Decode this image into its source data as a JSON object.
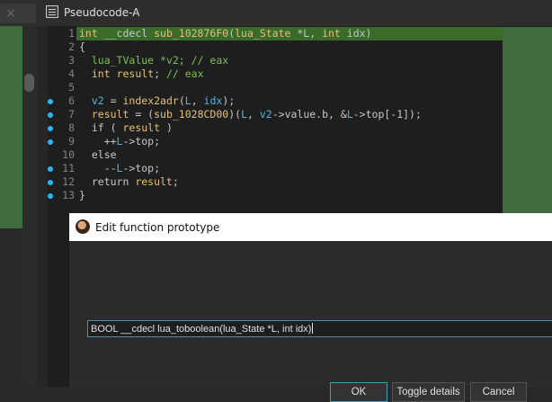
{
  "window": {
    "tab_title": "Pseudocode-A",
    "tab_close_glyph": "×"
  },
  "editor": {
    "lines": [
      {
        "num": "1",
        "bp": false,
        "html": "<span class=\"kw\">int</span> __cdecl <span class=\"fn\">sub_102876F0</span>(<span class=\"kw\">lua_State</span> *L, <span class=\"kw\">int</span> idx)"
      },
      {
        "num": "2",
        "bp": false,
        "html": "{"
      },
      {
        "num": "3",
        "bp": false,
        "html": "  <span class=\"cmt\">lua_TValue *v2; // eax</span>"
      },
      {
        "num": "4",
        "bp": false,
        "html": "  <span class=\"kw\">int</span> <span class=\"kw\">result</span>; <span class=\"cmt\">// eax</span>"
      },
      {
        "num": "5",
        "bp": false,
        "html": ""
      },
      {
        "num": "6",
        "bp": true,
        "html": "  <span class=\"vr\">v2</span> = <span class=\"fn\">index2adr</span>(<span class=\"vr\">L</span>, <span class=\"vr\">idx</span>);"
      },
      {
        "num": "7",
        "bp": true,
        "html": "  <span class=\"kw\">result</span> = (<span class=\"fn\">sub_1028CD00</span>)(<span class=\"vr\">L</span>, <span class=\"vr\">v2</span>-&gt;value.b, &amp;<span class=\"vr\">L</span>-&gt;top[-1]);"
      },
      {
        "num": "8",
        "bp": true,
        "html": "  if ( <span class=\"kw\">result</span> )"
      },
      {
        "num": "9",
        "bp": true,
        "html": "    ++<span class=\"vr\">L</span>-&gt;top;"
      },
      {
        "num": "10",
        "bp": false,
        "html": "  else"
      },
      {
        "num": "11",
        "bp": true,
        "html": "    --<span class=\"vr\">L</span>-&gt;top;"
      },
      {
        "num": "12",
        "bp": true,
        "html": "  return <span class=\"kw\">result</span>;"
      },
      {
        "num": "13",
        "bp": true,
        "html": "}"
      }
    ]
  },
  "dialog": {
    "title": "Edit function prototype",
    "prototype_value": "BOOL __cdecl lua_toboolean(lua_State *L, int idx)",
    "ok_label": "OK",
    "toggle_label": "Toggle details",
    "cancel_label": "Cancel"
  },
  "colors": {
    "accent": "#29b6f6",
    "highlight_green": "#3f6c3c",
    "keyword": "#e5c07b",
    "comment": "#7fbf59",
    "variable": "#56b6e0"
  },
  "icons": [
    "close-icon",
    "pseudocode-tab-icon",
    "breakpoint-icon",
    "avatar-icon"
  ]
}
